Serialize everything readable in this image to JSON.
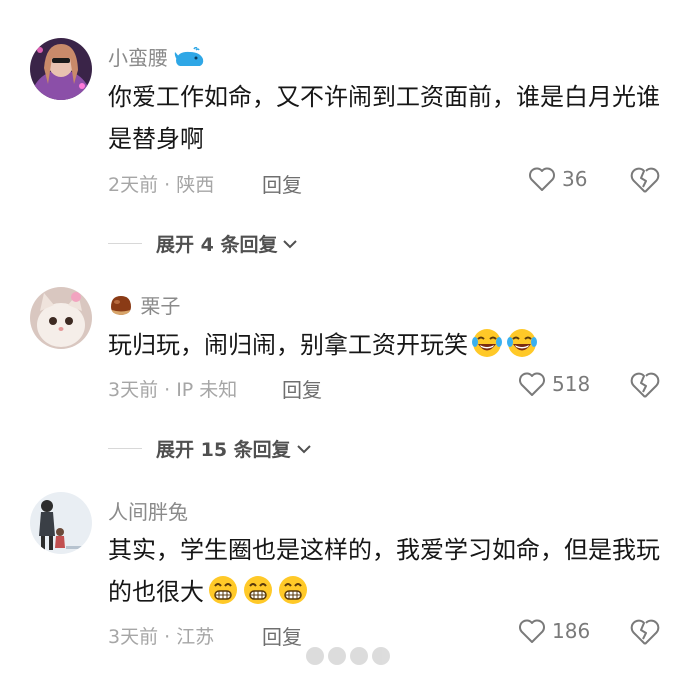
{
  "comments": [
    {
      "username": "小蛮腰",
      "text": "你爱工作如命，又不许闹到工资面前，谁是白月光谁是替身啊",
      "meta": "2天前 · 陕西",
      "reply_label": "回复",
      "likes": "36",
      "expand_label": "展开 4 条回复",
      "avatar_color": "#6b3f86",
      "username_badge": "whale-icon"
    },
    {
      "username": "栗子",
      "text": "玩归玩，闹归闹，别拿工资开玩笑",
      "meta": "3天前 · IP 未知",
      "reply_label": "回复",
      "likes": "518",
      "expand_label": "展开 15 条回复",
      "avatar_color": "#e9d7cf",
      "username_badge": "chestnut-icon",
      "emojis": [
        "laugh-cry-emoji",
        "laugh-cry-emoji"
      ]
    },
    {
      "username": "人间胖兔",
      "text": "其实，学生圈也是这样的，我爱学习如命，但是我玩的也很大",
      "meta": "3天前 · 江苏",
      "reply_label": "回复",
      "likes": "186",
      "avatar_color": "#dfe6ee",
      "emojis": [
        "grin-emoji",
        "grin-emoji",
        "grin-emoji"
      ]
    }
  ],
  "colors": {
    "emoji_yellow": "#ffc928",
    "username_gray": "#8a8a8a",
    "meta_gray": "#a6a6a6"
  }
}
